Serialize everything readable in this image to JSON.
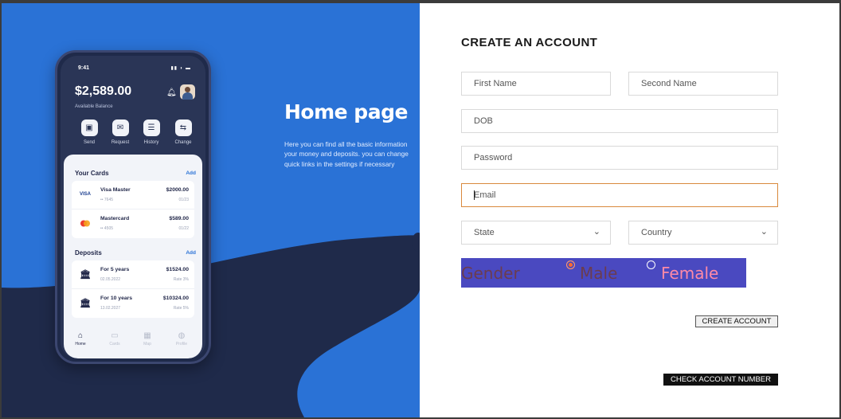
{
  "hero": {
    "title": "Home page",
    "description": "Here you can find all the basic information\nyour money and deposits. you can change\nquick links in the settings if necessary"
  },
  "phone": {
    "time": "9:41",
    "balance": "$2,589.00",
    "balance_label": "Available Balance",
    "quick_actions": [
      {
        "label": "Send",
        "icon": "money-icon"
      },
      {
        "label": "Request",
        "icon": "inbox-icon"
      },
      {
        "label": "History",
        "icon": "history-icon"
      },
      {
        "label": "Change",
        "icon": "exchange-icon"
      }
    ],
    "cards_title": "Your Cards",
    "cards_add": "Add",
    "cards": [
      {
        "name": "Visa Master",
        "number": "•• 7645",
        "amount": "$2000.00",
        "expiry": "01/23",
        "logo": "VISA"
      },
      {
        "name": "Mastercard",
        "number": "•• 4505",
        "amount": "$589.00",
        "expiry": "01/22",
        "logo": "MC"
      }
    ],
    "deposits_title": "Deposits",
    "deposits_add": "Add",
    "deposits": [
      {
        "name": "For 5 years",
        "date": "02.05.2022",
        "amount": "$1524.00",
        "rate": "Rate 3%"
      },
      {
        "name": "For 10 years",
        "date": "13.02.2027",
        "amount": "$10324.00",
        "rate": "Rate 5%"
      }
    ],
    "tabs": [
      {
        "label": "Home",
        "icon": "home-icon"
      },
      {
        "label": "Cards",
        "icon": "wallet-icon"
      },
      {
        "label": "Map",
        "icon": "map-icon"
      },
      {
        "label": "Profile",
        "icon": "globe-icon"
      }
    ]
  },
  "form": {
    "title": "CREATE AN ACCOUNT",
    "first_name": "First Name",
    "second_name": "Second Name",
    "dob": "DOB",
    "password": "Password",
    "email": "Email",
    "state": "State",
    "country": "Country",
    "gender_label": "Gender",
    "male_label": "Male",
    "female_label": "Female",
    "selected_gender": "Male",
    "create_button": "CREATE ACCOUNT",
    "check_button": "CHECK ACCOUNT NUMBER"
  },
  "colors": {
    "hero_blue": "#2a72d6",
    "dark_navy": "#1f2a4a",
    "gender_bg": "#4a49c0",
    "focus_border": "#d9893c"
  }
}
